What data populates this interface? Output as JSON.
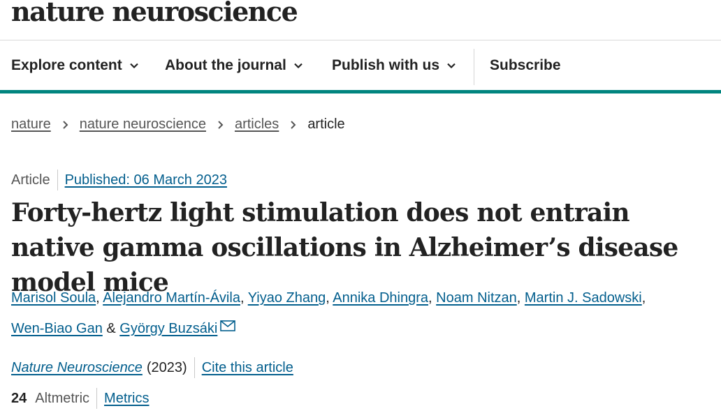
{
  "site": {
    "logo": "nature neuroscience"
  },
  "nav": {
    "items": [
      {
        "label": "Explore content"
      },
      {
        "label": "About the journal"
      },
      {
        "label": "Publish with us"
      }
    ],
    "subscribe": "Subscribe"
  },
  "breadcrumb": {
    "items": [
      "nature",
      "nature neuroscience",
      "articles"
    ],
    "current": "article"
  },
  "article": {
    "type": "Article",
    "published": "Published: 06 March 2023",
    "title": "Forty-hertz light stimulation does not entrain native gamma oscillations in Alzheimer’s disease model mice",
    "authors": [
      "Marisol Soula",
      "Alejandro Martín-Ávila",
      "Yiyao Zhang",
      "Annika Dhingra",
      "Noam Nitzan",
      "Martin J. Sadowski",
      "Wen-Biao Gan",
      "György Buzsáki"
    ],
    "ampersand": "&",
    "comma": ",",
    "journal": "Nature Neuroscience",
    "year": "(2023)",
    "cite": "Cite this article"
  },
  "metrics": {
    "altmetric_count": "24",
    "altmetric_label": "Altmetric",
    "metrics_link": "Metrics"
  },
  "colors": {
    "accent": "#00857f",
    "link": "#025e8d",
    "text": "#222222",
    "muted": "#555555"
  },
  "icons": {
    "nav_dropdown": "chevron-down-icon",
    "breadcrumb_sep": "chevron-right-icon",
    "corresponding_author": "mail-icon"
  }
}
